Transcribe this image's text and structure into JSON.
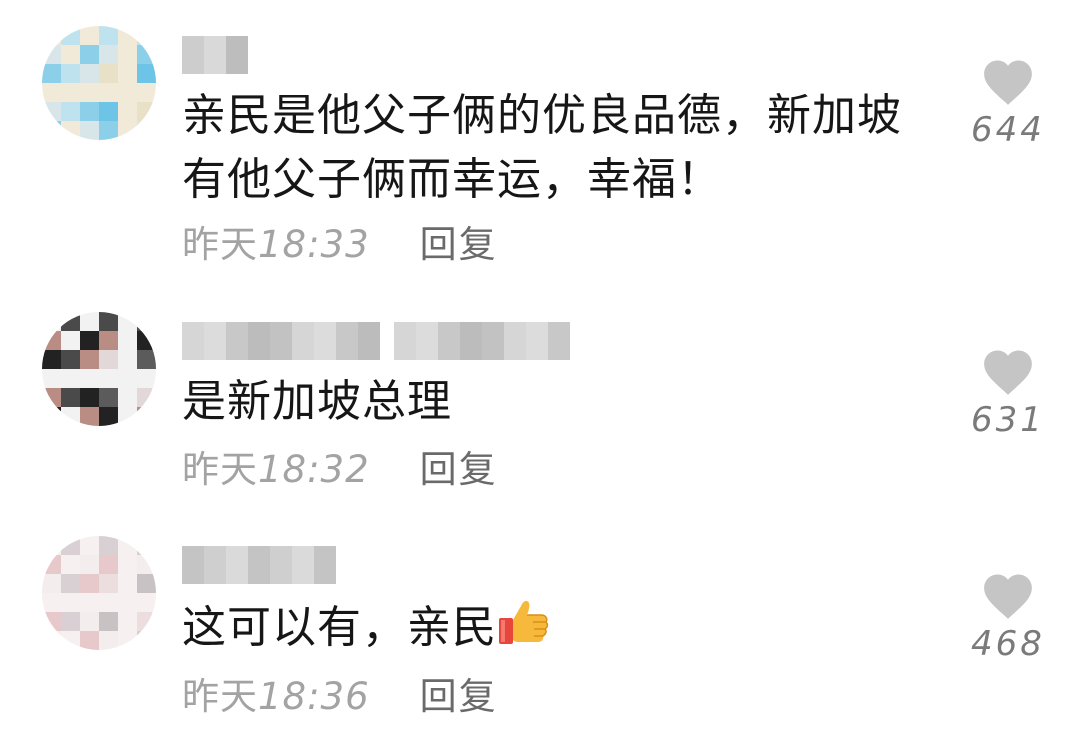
{
  "comments": [
    {
      "text": "亲民是他父子俩的优良品德，新加坡有他父子俩而幸运，幸福！",
      "time_prefix": "昨天",
      "time_value": "18:33",
      "reply_label": "回复",
      "likes": "644",
      "username_blur_colors": [
        "#cdcdcd",
        "#d9d9d9",
        "#bdbdbd"
      ],
      "avatar_colors": [
        "#f1ead8",
        "#e9e0c8",
        "#d8e6ea",
        "#bfe2ef",
        "#8ccfe8",
        "#6ec4e6"
      ]
    },
    {
      "text": "是新加坡总理",
      "time_prefix": "昨天",
      "time_value": "18:32",
      "reply_label": "回复",
      "likes": "631",
      "username_blur_colors": [
        "#c8c8c8",
        "#d6d6d6",
        "#bcbcbc",
        "#dcdcdc",
        "#c2c2c2"
      ],
      "avatar_colors": [
        "#f2f2f2",
        "#e3d8d8",
        "#b98c84",
        "#4a4a4a",
        "#222222",
        "#5b5b5b"
      ]
    },
    {
      "text": "这可以有，亲民",
      "emoji": "thumbs-up",
      "time_prefix": "昨天",
      "time_value": "18:36",
      "reply_label": "回复",
      "likes": "468",
      "username_blur_colors": [
        "#cfcfcf",
        "#dadada",
        "#c4c4c4"
      ],
      "avatar_colors": [
        "#f6f0f0",
        "#ecdede",
        "#e7c9cc",
        "#d9d0d3",
        "#f3eded",
        "#c9c2c5"
      ]
    }
  ],
  "colors": {
    "heart": "#c5c5c5",
    "text": "#161616",
    "timestamp": "#a3a3a3",
    "reply": "#6a6a6a",
    "likes": "#7a7a7a"
  },
  "icons": {
    "like": "heart-icon",
    "emoji": "thumbs-up-icon"
  }
}
